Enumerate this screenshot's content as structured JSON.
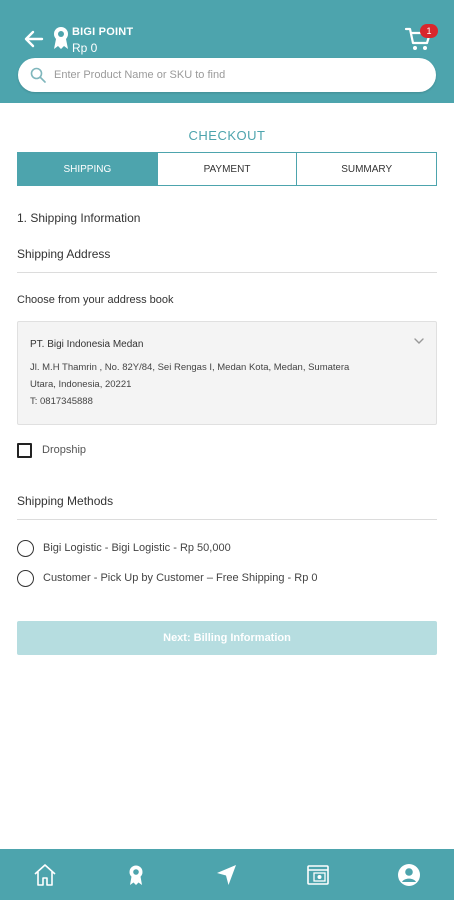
{
  "header": {
    "points_label": "BIGI POINT",
    "points_value": "Rp  0",
    "cart_count": "1",
    "icons": [
      "back-arrow-icon",
      "ribbon-badge-icon",
      "cart-icon"
    ]
  },
  "search": {
    "placeholder": "Enter Product Name or SKU to find",
    "value": ""
  },
  "page": {
    "title": "CHECKOUT"
  },
  "steps": [
    {
      "label": "SHIPPING",
      "active": true
    },
    {
      "label": "PAYMENT",
      "active": false
    },
    {
      "label": "SUMMARY",
      "active": false
    }
  ],
  "shipping": {
    "section_title": "1. Shipping Information",
    "address_heading": "Shipping Address",
    "address_book_label": "Choose from your address book",
    "address": {
      "name": "PT. Bigi Indonesia Medan",
      "line1": "Jl. M.H Thamrin , No. 82Y/84, Sei Rengas I, Medan Kota, Medan, Sumatera",
      "line2": "Utara, Indonesia, 20221",
      "phone": "T: 0817345888"
    },
    "dropship_label": "Dropship",
    "dropship_checked": false,
    "methods_heading": "Shipping Methods",
    "methods": [
      {
        "label": "Bigi Logistic - Bigi Logistic - Rp  50,000",
        "selected": false
      },
      {
        "label": "Customer - Pick Up by Customer – Free Shipping - Rp  0",
        "selected": false
      }
    ],
    "next_button": "Next: Billing Information"
  },
  "bottom_nav": [
    "home-icon",
    "ribbon-badge-icon",
    "navigation-arrow-icon",
    "catalog-icon",
    "account-icon"
  ],
  "colors": {
    "primary": "#4da4ad",
    "button_disabled": "#b6dde0",
    "badge": "#d9262c"
  }
}
